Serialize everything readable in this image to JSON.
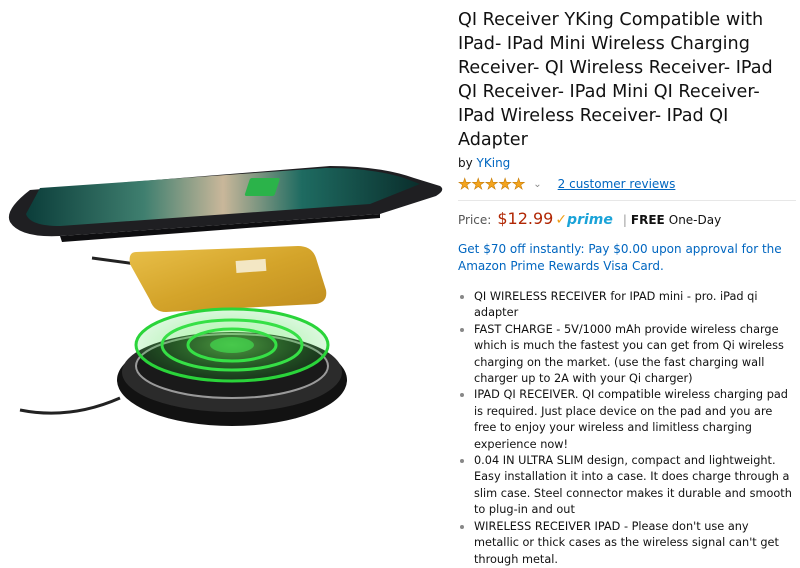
{
  "product": {
    "title": "QI Receiver YKing Compatible with IPad- IPad Mini Wireless Charging Receiver- QI Wireless Receiver- IPad QI Receiver- IPad Mini QI Receiver- IPad Wireless Receiver- IPad QI Adapter",
    "by_label": "by",
    "brand": "YKing",
    "rating_stars": 5,
    "reviews_text": "2 customer reviews"
  },
  "price": {
    "label": "Price:",
    "amount": "$12.99",
    "prime_word": "prime",
    "free_label": "FREE",
    "shipping": "One-Day"
  },
  "promo": "Get $70 off instantly: Pay $0.00 upon approval for the Amazon Prime Rewards Visa Card.",
  "bullets": [
    "QI WIRELESS RECEIVER for IPAD mini - pro. iPad qi adapter",
    "FAST CHARGE - 5V/1000 mAh provide wireless charge which is much the fastest you can get from Qi wireless charging on the market. (use the fast charging wall charger up to 2A with your Qi charger)",
    "IPAD QI RECEIVER. QI compatible wireless charging pad is required. Just place device on the pad and you are free to enjoy your wireless and limitless charging experience now!",
    "0.04 IN ULTRA SLIM design, compact and lightweight. Easy installation it into a case. It does charge through a slim case. Steel connector makes it durable and smooth to plug-in and out",
    "WIRELESS RECEIVER IPAD - Please don't use any metallic or thick cases as the wireless signal can't get through metal."
  ],
  "colors": {
    "link": "#0066c0",
    "price": "#b12704",
    "star": "#f4a41d",
    "prime": "#1aa3d8"
  },
  "icons": [
    "star-icon",
    "chevron-down-icon",
    "prime-check-icon"
  ]
}
